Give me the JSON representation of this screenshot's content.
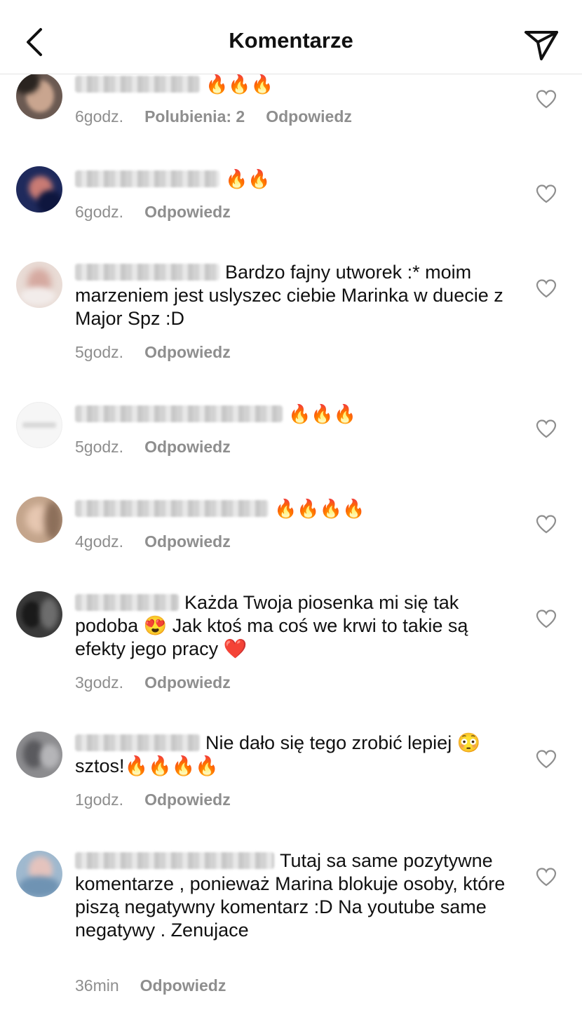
{
  "header": {
    "title": "Komentarze",
    "back_icon": "chevron-left-icon",
    "share_icon": "paper-plane-icon"
  },
  "reply_label": "Odpowiedz",
  "comments": [
    {
      "text": "🔥🔥🔥",
      "time": "6godz.",
      "likes": "Polubienia: 2"
    },
    {
      "text": "🔥🔥",
      "time": "6godz."
    },
    {
      "text": "Bardzo fajny utworek :* moim marzeniem jest uslyszec ciebie Marinka w duecie z Major Spz :D",
      "time": "5godz."
    },
    {
      "text": "🔥🔥🔥",
      "time": "5godz."
    },
    {
      "text": "🔥🔥🔥🔥",
      "time": "4godz."
    },
    {
      "text": "Każda Twoja piosenka mi się tak podoba 😍 Jak ktoś ma coś we krwi to takie są efekty jego pracy ❤️",
      "time": "3godz."
    },
    {
      "text": "Nie dało się tego zrobić lepiej 😳 sztos!🔥🔥🔥🔥",
      "time": "1godz."
    },
    {
      "text": "Tutaj sa same pozytywne komentarze , ponieważ Marina blokuje osoby, które piszą negatywny komentarz :D Na youtube same negatywy . Zenujace",
      "time": "36min"
    }
  ]
}
